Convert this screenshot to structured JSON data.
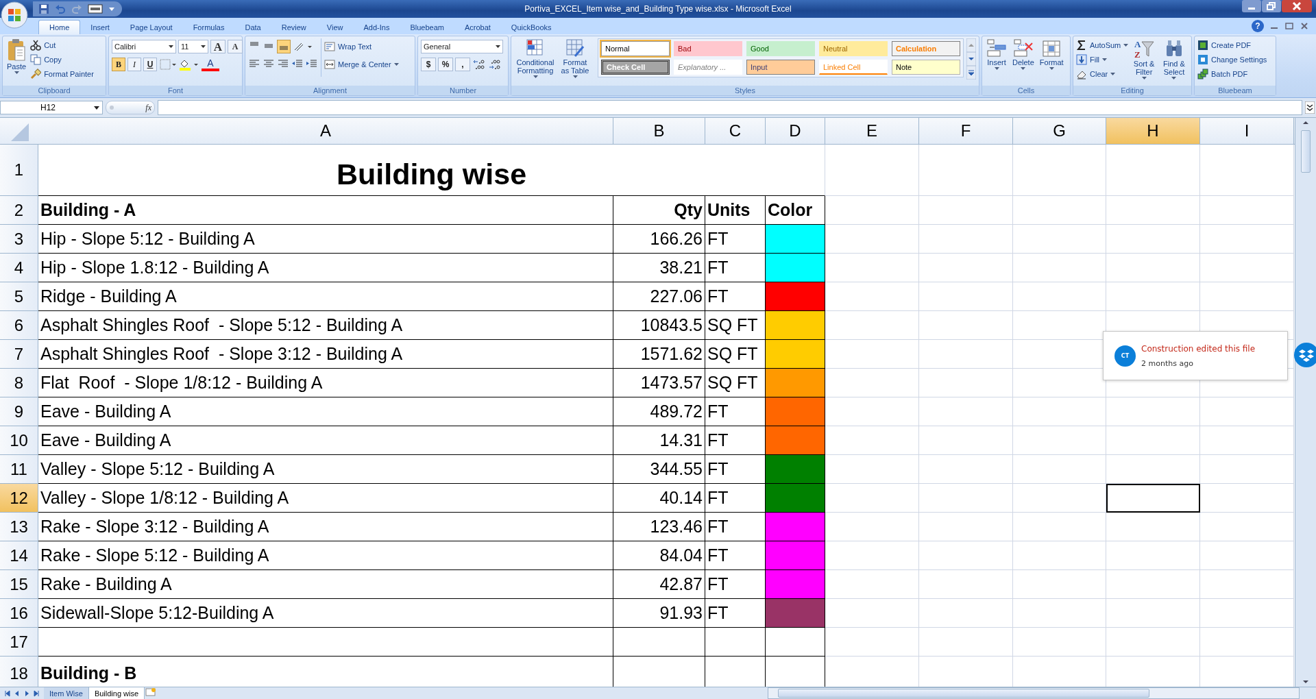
{
  "window": {
    "title": "Portiva_EXCEL_Item wise_and_Building Type wise.xlsx - Microsoft Excel"
  },
  "ribbon_tabs": [
    {
      "label": "Home",
      "selected": true
    },
    {
      "label": "Insert",
      "selected": false
    },
    {
      "label": "Page Layout",
      "selected": false
    },
    {
      "label": "Formulas",
      "selected": false
    },
    {
      "label": "Data",
      "selected": false
    },
    {
      "label": "Review",
      "selected": false
    },
    {
      "label": "View",
      "selected": false
    },
    {
      "label": "Add-Ins",
      "selected": false
    },
    {
      "label": "Bluebeam",
      "selected": false
    },
    {
      "label": "Acrobat",
      "selected": false
    },
    {
      "label": "QuickBooks",
      "selected": false
    }
  ],
  "clipboard": {
    "label": "Clipboard",
    "paste": "Paste",
    "items": [
      "Cut",
      "Copy",
      "Format Painter"
    ]
  },
  "help": "?",
  "font": {
    "label": "Font",
    "name": "Calibri",
    "size": "11",
    "grow": "A",
    "shrink": "A",
    "color_glyph": "A",
    "buttons": [
      {
        "label": "B",
        "on": true
      },
      {
        "label": "I",
        "on": false
      },
      {
        "label": "U",
        "on": false
      }
    ]
  },
  "alignment": {
    "label": "Alignment",
    "vertical": [
      {
        "on": false
      },
      {
        "on": false
      },
      {
        "on": true
      }
    ],
    "wrap": "Wrap Text",
    "merge": "Merge & Center"
  },
  "number": {
    "label": "Number",
    "format": "General",
    "symbols": [
      "$",
      "%",
      ","
    ]
  },
  "styles": {
    "label": "Styles",
    "commands": [
      "Conditional Formatting",
      "Format as Table"
    ],
    "gallery": [
      {
        "label": "Normal",
        "kind": "normal",
        "selected": true
      },
      {
        "label": "Bad",
        "kind": "bad",
        "selected": false
      },
      {
        "label": "Good",
        "kind": "good",
        "selected": false
      },
      {
        "label": "Neutral",
        "kind": "neutral",
        "selected": false
      },
      {
        "label": "Calculation",
        "kind": "calculation",
        "selected": false
      },
      {
        "label": "Check Cell",
        "kind": "check",
        "selected": false
      },
      {
        "label": "Explanatory ...",
        "kind": "explanatory",
        "selected": false
      },
      {
        "label": "Input",
        "kind": "input",
        "selected": false
      },
      {
        "label": "Linked Cell",
        "kind": "linked",
        "selected": false
      },
      {
        "label": "Note",
        "kind": "note",
        "selected": false
      }
    ]
  },
  "cells": {
    "label": "Cells",
    "commands": [
      "Insert",
      "Delete",
      "Format"
    ]
  },
  "editing": {
    "label": "Editing",
    "sort_glyphs": [
      "A",
      "Z"
    ],
    "small": [
      "AutoSum",
      "Fill",
      "Clear"
    ],
    "large": [
      "Sort & Filter",
      "Find & Select"
    ]
  },
  "bluebeam": {
    "label": "Bluebeam",
    "commands": [
      "Create PDF",
      "Change Settings",
      "Batch PDF"
    ]
  },
  "formula_bar": {
    "name_box": "H12",
    "fx": "fx"
  },
  "columns": [
    {
      "label": "A",
      "selected": false
    },
    {
      "label": "B",
      "selected": false
    },
    {
      "label": "C",
      "selected": false
    },
    {
      "label": "D",
      "selected": false
    },
    {
      "label": "E",
      "selected": false
    },
    {
      "label": "F",
      "selected": false
    },
    {
      "label": "G",
      "selected": false
    },
    {
      "label": "H",
      "selected": true
    },
    {
      "label": "I",
      "selected": false
    }
  ],
  "rows": [
    {
      "number": "1",
      "selected": false,
      "kind": "title",
      "text": "Building wise"
    },
    {
      "number": "2",
      "selected": false,
      "kind": "header",
      "cells": [
        "Building - A",
        "Qty",
        "Units",
        "Color"
      ]
    },
    {
      "number": "3",
      "selected": false,
      "kind": "item",
      "item": "Hip - Slope 5:12 - Building A",
      "qty": "166.26",
      "units": "FT",
      "color": "#00ffff"
    },
    {
      "number": "4",
      "selected": false,
      "kind": "item",
      "item": "Hip - Slope 1.8:12 - Building A",
      "qty": "38.21",
      "units": "FT",
      "color": "#00ffff"
    },
    {
      "number": "5",
      "selected": false,
      "kind": "item",
      "item": "Ridge - Building A",
      "qty": "227.06",
      "units": "FT",
      "color": "#ff0000"
    },
    {
      "number": "6",
      "selected": false,
      "kind": "item",
      "item": "Asphalt Shingles Roof  - Slope 5:12 - Building A",
      "qty": "10843.5",
      "units": "SQ FT",
      "color": "#ffcc00"
    },
    {
      "number": "7",
      "selected": false,
      "kind": "item",
      "item": "Asphalt Shingles Roof  - Slope 3:12 - Building A",
      "qty": "1571.62",
      "units": "SQ FT",
      "color": "#ffcc00"
    },
    {
      "number": "8",
      "selected": false,
      "kind": "item",
      "item": "Flat  Roof  - Slope 1/8:12 - Building A",
      "qty": "1473.57",
      "units": "SQ FT",
      "color": "#ff9900"
    },
    {
      "number": "9",
      "selected": false,
      "kind": "item",
      "item": "Eave - Building A",
      "qty": "489.72",
      "units": "FT",
      "color": "#ff6600"
    },
    {
      "number": "10",
      "selected": false,
      "kind": "item",
      "item": "Eave - Building A",
      "qty": "14.31",
      "units": "FT",
      "color": "#ff6600"
    },
    {
      "number": "11",
      "selected": false,
      "kind": "item",
      "item": "Valley - Slope 5:12 - Building A",
      "qty": "344.55",
      "units": "FT",
      "color": "#008000"
    },
    {
      "number": "12",
      "selected": true,
      "kind": "item",
      "item": "Valley - Slope 1/8:12 - Building A",
      "qty": "40.14",
      "units": "FT",
      "color": "#008000"
    },
    {
      "number": "13",
      "selected": false,
      "kind": "item",
      "item": "Rake - Slope 3:12 - Building A",
      "qty": "123.46",
      "units": "FT",
      "color": "#ff00ff"
    },
    {
      "number": "14",
      "selected": false,
      "kind": "item",
      "item": "Rake - Slope 5:12 - Building A",
      "qty": "84.04",
      "units": "FT",
      "color": "#ff00ff"
    },
    {
      "number": "15",
      "selected": false,
      "kind": "item",
      "item": "Rake - Building A",
      "qty": "42.87",
      "units": "FT",
      "color": "#ff00ff"
    },
    {
      "number": "16",
      "selected": false,
      "kind": "item",
      "item": "Sidewall-Slope 5:12-Building A",
      "qty": "91.93",
      "units": "FT",
      "color": "#993366"
    },
    {
      "number": "17",
      "selected": false,
      "kind": "blank"
    },
    {
      "number": "18",
      "selected": false,
      "kind": "section",
      "text": "Building - B"
    }
  ],
  "comment": {
    "avatar": "CT",
    "message": "Construction edited this file",
    "time": "2 months ago"
  },
  "sheet_tabs": [
    {
      "label": "Item Wise",
      "selected": false
    },
    {
      "label": "Building wise",
      "selected": true
    }
  ]
}
